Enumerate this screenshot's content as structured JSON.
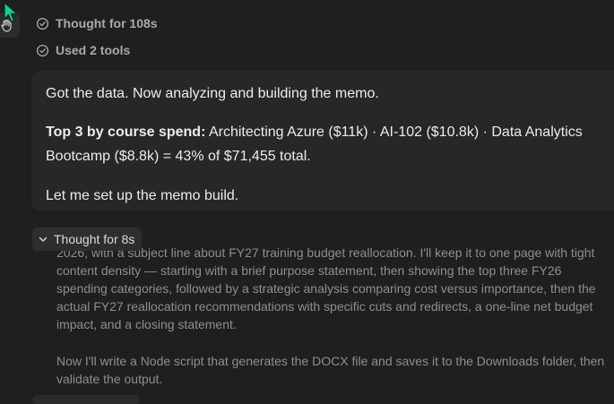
{
  "status": {
    "thought_label": "Thought for 108s",
    "tools_label": "Used 2 tools"
  },
  "message": {
    "intro": "Got the data. Now analyzing and building the memo.",
    "top_label": "Top 3 by course spend:",
    "top_text": " Architecting Azure ($11k) · AI-102 ($10.8k) · Data Analytics Bootcamp ($8.8k) = 43% of $71,455 total.",
    "closing": "Let me set up the memo build."
  },
  "thought": {
    "toggle_label": "Thought for 8s",
    "para1": "2026, with a subject line about FY27 training budget reallocation. I'll keep it to one page with tight content density — starting with a brief purpose statement, then showing the top three FY26 spending categories, followed by a strategic analysis comparing cost versus importance, then the actual FY27 reallocation recommendations with specific cuts and redirects, a one-line net budget impact, and a closing statement.",
    "para2": "Now I'll write a Node script that generates the DOCX file and saves it to the Downloads folder, then validate the output."
  },
  "icons": {
    "avatar": "hand-icon",
    "check": "check-circle-icon",
    "chevron": "chevron-down-icon",
    "cursor": "cursor-arrow-icon"
  },
  "colors": {
    "background": "#1f1f1f",
    "bubble": "#272727",
    "muted_text": "#a9a9a9",
    "cursor": "#1ec98a"
  }
}
